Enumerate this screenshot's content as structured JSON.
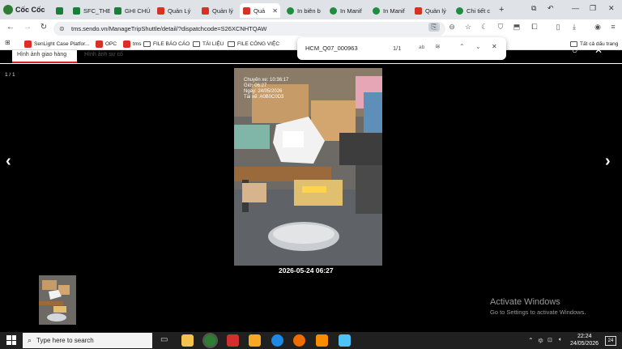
{
  "browser": {
    "brand": "Cốc Cốc",
    "tabs": [
      {
        "label": "",
        "icon": "sheet-icon"
      },
      {
        "label": "SFC_THE",
        "icon": "sheet-icon"
      },
      {
        "label": "GHI CHÚ",
        "icon": "sheet-icon"
      },
      {
        "label": "Quản Lý",
        "icon": "sendo-icon"
      },
      {
        "label": "Quản lý",
        "icon": "sendo-icon"
      },
      {
        "label": "Quả",
        "icon": "sendo-icon",
        "active": true
      },
      {
        "label": "In biên b",
        "icon": "globe-icon"
      },
      {
        "label": "In Manif",
        "icon": "globe-icon"
      },
      {
        "label": "In Manif",
        "icon": "globe-icon"
      },
      {
        "label": "Quản lý",
        "icon": "sendo-icon"
      },
      {
        "label": "Chi tiết c",
        "icon": "globe-icon"
      }
    ],
    "url": "tms.sendo.vn/ManageTripShuttle/detail/?dispatchcode=S26XCNHTQAW",
    "bookmarks": [
      {
        "label": "SenLight Case Platfor...",
        "icon": "sendo-icon"
      },
      {
        "label": "OPC",
        "icon": "sendo-icon"
      },
      {
        "label": "tms",
        "icon": "sendo-icon"
      },
      {
        "label": "FILE BÁO CÁO",
        "icon": "folder-icon"
      },
      {
        "label": "TÀI LIỆU",
        "icon": "folder-icon"
      },
      {
        "label": "FILE CÔNG VIỆC",
        "icon": "folder-icon"
      }
    ],
    "all_bookmarks": "Tất cả dấu trang"
  },
  "find": {
    "query": "HCM_Q07_000963",
    "count": "1/1",
    "match_case": "ab"
  },
  "page": {
    "tab_goods": "Hình ảnh giao hàng",
    "tab_incident": "Hình ảnh sự cố",
    "counter": "1 / 1",
    "photo_overlay": [
      "Chuyến xe: 10:36:17",
      "Giờ: 06:27",
      "Ngày: 24/05/2026",
      "Tài xế: A0B0C0D3"
    ],
    "timestamp": "2026-05-24 06:27",
    "prev": "‹",
    "next": "›"
  },
  "watermark": {
    "title": "Activate Windows",
    "subtitle": "Go to Settings to activate Windows."
  },
  "taskbar": {
    "search_placeholder": "Type here to search",
    "time": "22:24",
    "date": "24/05/2026",
    "notif_count": "24"
  }
}
